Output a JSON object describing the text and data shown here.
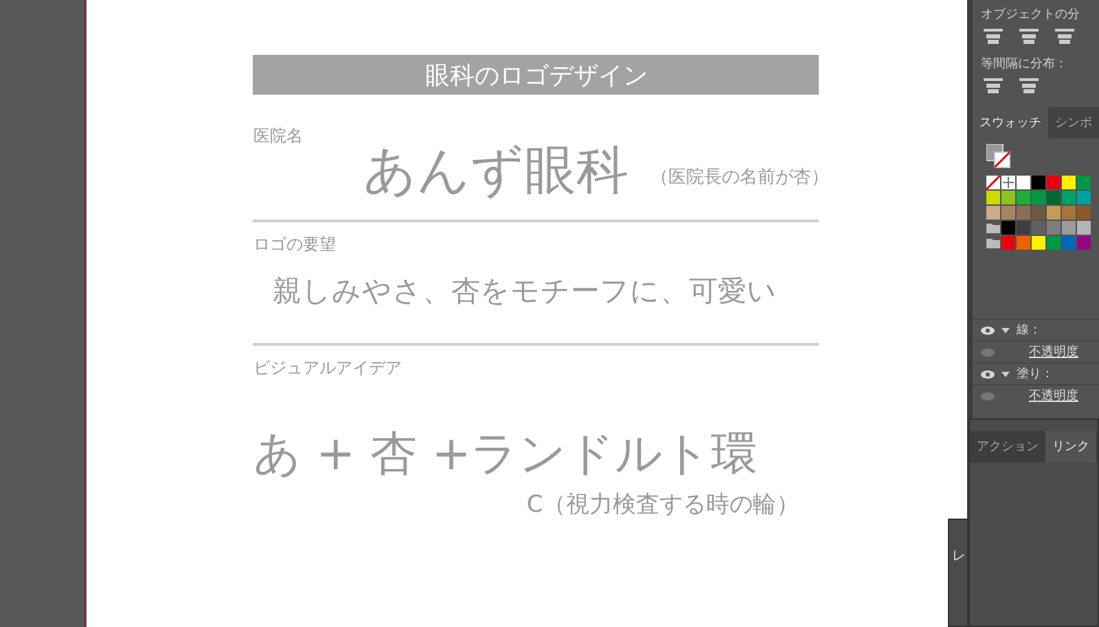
{
  "document": {
    "title": "眼科のロゴデザイン",
    "sections": [
      {
        "kind": "inline",
        "label": "医院名",
        "main": "あんず眼科",
        "note": "（医院長の名前が杏）"
      },
      {
        "kind": "plain",
        "label": "ロゴの要望",
        "main": "親しみやさ、杏をモチーフに、可愛い"
      },
      {
        "kind": "below",
        "label": "ビジュアルアイデア",
        "main": "あ + 杏 +ランドルト環",
        "note": "C（視力検査する時の輪）"
      }
    ]
  },
  "align_panel": {
    "title": "オブジェクトの分",
    "spacing_label": "等間隔に分布："
  },
  "swatch_panel": {
    "tabs": [
      {
        "label": "スウォッチ",
        "selected": true
      },
      {
        "label": "シンボ",
        "selected": false
      }
    ],
    "rows": [
      [
        {
          "kind": "none"
        },
        {
          "kind": "registration"
        },
        {
          "kind": "color",
          "color": "#ffffff"
        },
        {
          "kind": "color",
          "color": "#000000"
        },
        {
          "kind": "color",
          "color": "#e60012"
        },
        {
          "kind": "color",
          "color": "#fff100"
        },
        {
          "kind": "color",
          "color": "#009944"
        }
      ],
      [
        {
          "kind": "color",
          "color": "#cfdb00"
        },
        {
          "kind": "color",
          "color": "#8fc31f"
        },
        {
          "kind": "color",
          "color": "#22ac38"
        },
        {
          "kind": "color",
          "color": "#009944"
        },
        {
          "kind": "color",
          "color": "#006934"
        },
        {
          "kind": "color",
          "color": "#00a06a"
        },
        {
          "kind": "color",
          "color": "#00a0a0"
        }
      ],
      [
        {
          "kind": "color",
          "color": "#c9ad8a"
        },
        {
          "kind": "color",
          "color": "#a58663"
        },
        {
          "kind": "color",
          "color": "#8a6f56"
        },
        {
          "kind": "color",
          "color": "#6d5846"
        },
        {
          "kind": "color",
          "color": "#c49a5a"
        },
        {
          "kind": "color",
          "color": "#a8743a"
        },
        {
          "kind": "color",
          "color": "#8c5a2a"
        }
      ],
      [
        {
          "kind": "folder"
        },
        {
          "kind": "color",
          "color": "#000000"
        },
        {
          "kind": "color",
          "color": "#3e3e3e"
        },
        {
          "kind": "color",
          "color": "#5f5f5f"
        },
        {
          "kind": "color",
          "color": "#7d7d7d"
        },
        {
          "kind": "color",
          "color": "#9b9b9b"
        },
        {
          "kind": "color",
          "color": "#b5b5b5"
        }
      ],
      [
        {
          "kind": "folder"
        },
        {
          "kind": "color",
          "color": "#e60012"
        },
        {
          "kind": "color",
          "color": "#eb6100"
        },
        {
          "kind": "color",
          "color": "#fff100"
        },
        {
          "kind": "color",
          "color": "#009944"
        },
        {
          "kind": "color",
          "color": "#0068b7"
        },
        {
          "kind": "color",
          "color": "#920783"
        }
      ]
    ]
  },
  "appearance_panel": {
    "rows": [
      {
        "kind": "attribute",
        "label": "線：",
        "visible": true
      },
      {
        "kind": "sub",
        "label": "不透明度",
        "visible": false
      },
      {
        "kind": "attribute",
        "label": "塗り：",
        "visible": true
      },
      {
        "kind": "sub",
        "label": "不透明度",
        "visible": false
      }
    ]
  },
  "links_panel": {
    "tabs": [
      {
        "label": "アクション",
        "selected": false
      },
      {
        "label": "リンク",
        "selected": true
      }
    ]
  },
  "small_panel": {
    "title": "レ"
  }
}
